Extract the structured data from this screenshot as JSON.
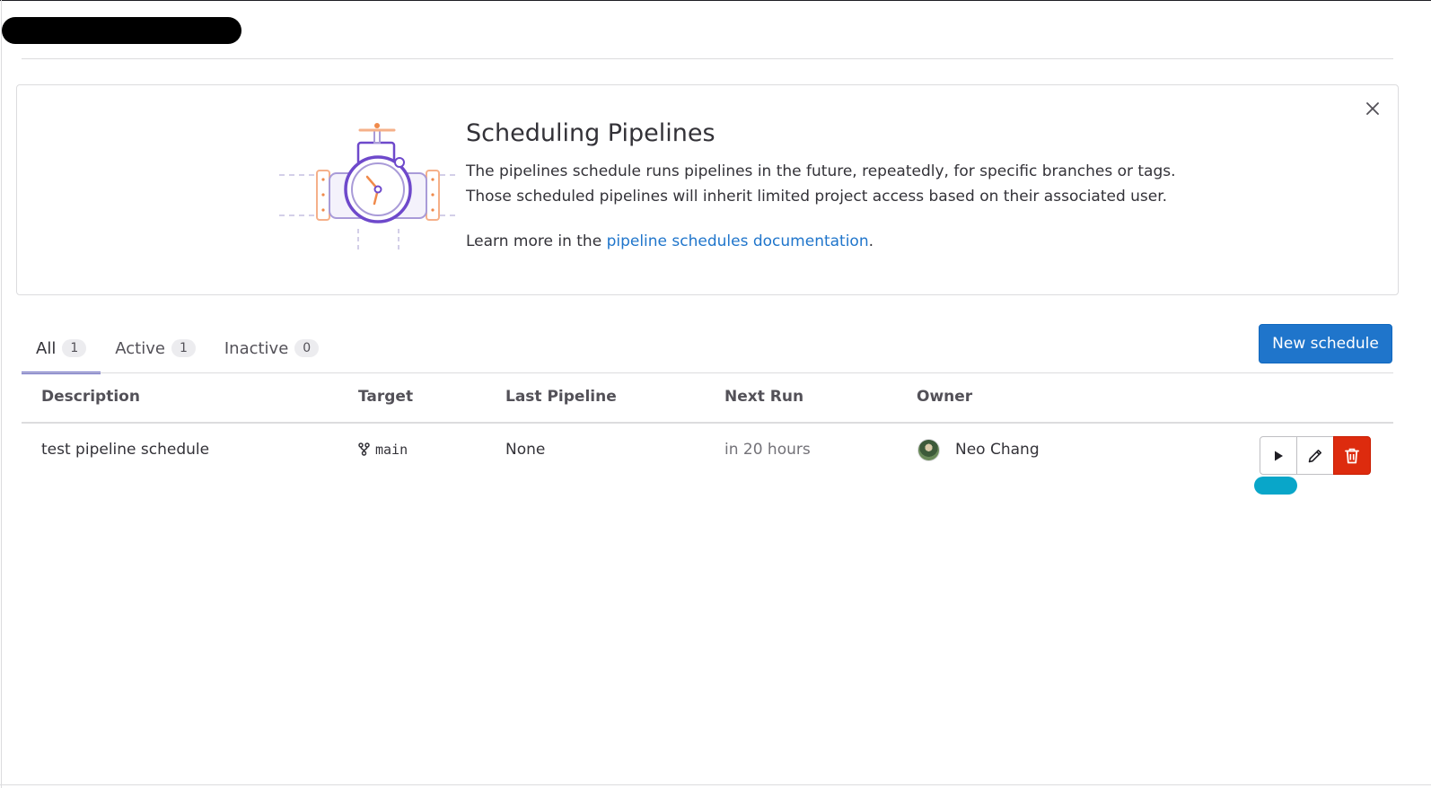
{
  "banner": {
    "title": "Scheduling Pipelines",
    "line1": "The pipelines schedule runs pipelines in the future, repeatedly, for specific branches or tags.",
    "line2": "Those scheduled pipelines will inherit limited project access based on their associated user.",
    "learn_prefix": "Learn more in the ",
    "learn_link": "pipeline schedules documentation",
    "learn_suffix": "."
  },
  "tabs": [
    {
      "label": "All",
      "count": "1"
    },
    {
      "label": "Active",
      "count": "1"
    },
    {
      "label": "Inactive",
      "count": "0"
    }
  ],
  "new_schedule_label": "New schedule",
  "table": {
    "headers": [
      "Description",
      "Target",
      "Last Pipeline",
      "Next Run",
      "Owner"
    ],
    "rows": [
      {
        "description": "test pipeline schedule",
        "target": "main",
        "last_pipeline": "None",
        "next_run": "in 20 hours",
        "owner": "Neo Chang"
      }
    ]
  },
  "colors": {
    "primary": "#1f75cb",
    "danger": "#dd2b0e",
    "tab_active": "#6666c4",
    "link": "#1f75cb"
  }
}
